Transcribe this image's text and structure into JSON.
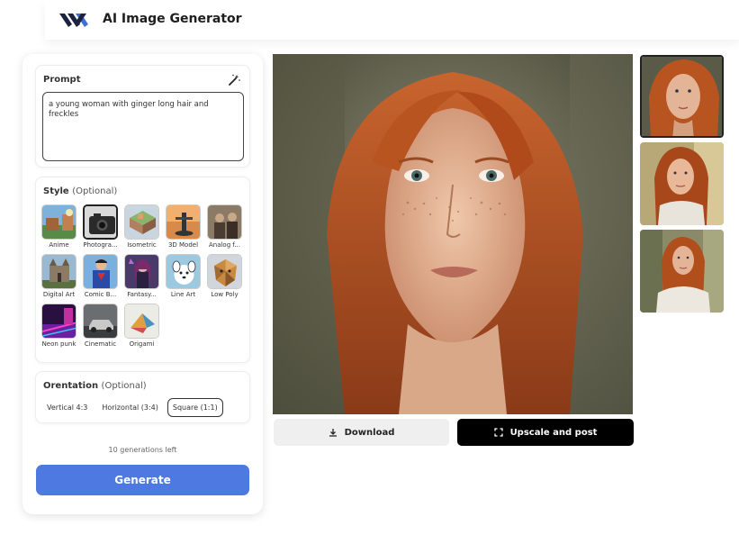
{
  "header": {
    "title": "AI Image Generator",
    "logo_icon": "logo-icon"
  },
  "prompt": {
    "title": "Prompt",
    "value": "a young woman with ginger long hair and freckles",
    "wand_icon": "magic-wand-icon"
  },
  "style": {
    "title": "Style",
    "optional": "(Optional)",
    "items": [
      {
        "label": "Anime",
        "selected": false
      },
      {
        "label": "Photogra...",
        "selected": true
      },
      {
        "label": "Isometric",
        "selected": false
      },
      {
        "label": "3D Model",
        "selected": false
      },
      {
        "label": "Analog f...",
        "selected": false
      },
      {
        "label": "Digital Art",
        "selected": false
      },
      {
        "label": "Comic B...",
        "selected": false
      },
      {
        "label": "Fantasy...",
        "selected": false
      },
      {
        "label": "Line Art",
        "selected": false
      },
      {
        "label": "Low Poly",
        "selected": false
      },
      {
        "label": "Neon punk",
        "selected": false
      },
      {
        "label": "Cinematic",
        "selected": false
      },
      {
        "label": "Origami",
        "selected": false
      }
    ]
  },
  "orientation": {
    "title": "Orentation",
    "optional": "(Optional)",
    "options": [
      {
        "label": "Vertical 4:3",
        "selected": false
      },
      {
        "label": "Horizontal (3:4)",
        "selected": false
      },
      {
        "label": "Square (1:1)",
        "selected": true
      }
    ]
  },
  "generations_left": "10 generations left",
  "generate_label": "Generate",
  "actions": {
    "download_label": "Download",
    "download_icon": "download-icon",
    "upscale_label": "Upscale and post",
    "upscale_icon": "expand-icon"
  },
  "colors": {
    "accent": "#4d79e0",
    "hair": "#b5562a",
    "skin": "#e8b79a"
  }
}
